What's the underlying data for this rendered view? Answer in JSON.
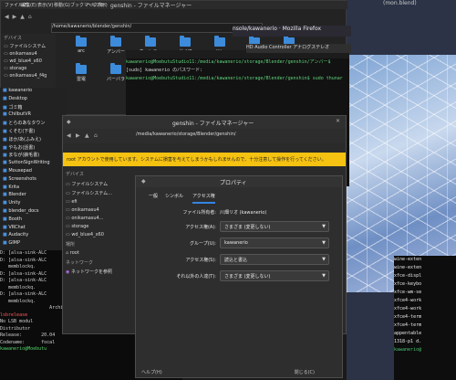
{
  "top_fm": {
    "title": "genshin - ファイルマネージャー",
    "menu": [
      "ファイル(F)",
      "編集(E)",
      "表示(V)",
      "移動(G)",
      "ブックマーク(B)",
      "ヘルプ(H)"
    ],
    "path": "/home/kawanerio/blender/genshin/",
    "sidebar_header": "デバイス",
    "sidebar": [
      "ファイルシステム",
      "onikamasu4",
      "wd_blue4_x60",
      "storage",
      "onikamasu4_f4g"
    ],
    "folders": [
      {
        "label": "arc"
      },
      {
        "label": "アンバー"
      },
      {
        "label": "ウェンティ"
      },
      {
        "label": "ガイア"
      },
      {
        "label": "ジン"
      },
      {
        "label": "バイモン"
      },
      {
        "label": "夜蘭"
      },
      {
        "label": "雷電"
      },
      {
        "label": "バーバラ"
      }
    ]
  },
  "left_list": [
    "kawanerio",
    "Desktop",
    "ゴミ箱",
    "ChilbutVR",
    "とらのあなタウン",
    "くそむ(下書)",
    "ほか/あ(ふみえ)",
    "やもお(話書)",
    "まなが(鋏毛書)",
    "SuttonSignWriting",
    "Mousepad",
    "Screenshots",
    "Krita",
    "Blender",
    "Unity",
    "blender_docs",
    "Booth",
    "VRChat",
    "Audacity",
    "GIMP"
  ],
  "terminal_lines": [
    {
      "text": "D: [alsa-sink-ALC",
      "cls": ""
    },
    {
      "text": "D: [alsa-sink-ALC",
      "cls": ""
    },
    {
      "text": "   memblockq.",
      "cls": ""
    },
    {
      "text": "D: [alsa-sink-ALC",
      "cls": ""
    },
    {
      "text": "D: [alsa-sink-ALC",
      "cls": ""
    },
    {
      "text": "   memblockq.",
      "cls": ""
    },
    {
      "text": "D: [alsa-sink-ALC",
      "cls": ""
    },
    {
      "text": "   memblockq.",
      "cls": ""
    },
    {
      "text": "                  Archit",
      "cls": ""
    },
    {
      "text": "lsbrelease",
      "cls": "red"
    },
    {
      "text": "No LSB modul",
      "cls": ""
    },
    {
      "text": "Distributor",
      "cls": ""
    },
    {
      "text": "Release:       20.04",
      "cls": ""
    },
    {
      "text": "Codename:      focal",
      "cls": ""
    },
    {
      "text": "kawanerio@Moebutu",
      "cls": "grn"
    }
  ],
  "upper_term": {
    "tabs": "nsole/kawanerio · Mozilla Firefox",
    "audio": "HD Audio Controller アナログステレオ",
    "lines": [
      {
        "text": "kawanerio@MoebutuStudio11:/media/kawanerio/storage/Blender/genshin/アンバー$",
        "cls": "g"
      },
      {
        "text": "[sudo] kawanerio のパスワード:",
        "cls": ""
      },
      {
        "text": "kawanerio@MoebutuStudio11:/media/kawanerio/storage/Blender/genshin$ sudo thunar",
        "cls": "g"
      }
    ]
  },
  "fm2": {
    "title": "genshin - ファイルマネージャー",
    "path": "/media/kawanerio/storage/Blender/genshin/",
    "warning": "root アカウントで使用しています。システムに損害を与えてしまうかもしれませんので、十分注意して操作を行ってください。",
    "side_header": "デバイス",
    "side": [
      "ファイルシステム",
      "ファイルシステム...",
      "efi",
      "onikamasu4",
      "onikamasu4...",
      "storage",
      "wd_blue4_x60"
    ],
    "places_header": "場所",
    "places": [
      "root"
    ],
    "net_header": "ネットワーク",
    "net": [
      "ネットワークを参照"
    ]
  },
  "dialog": {
    "title": "プロパティ",
    "tabs": [
      "一般",
      "シンボル",
      "アクセス権"
    ],
    "owner_label": "ファイル所有者:",
    "owner_value": "川畑リオ (kawanerio)",
    "access_label": "アクセス権(A):",
    "access_value": "さまざま (変更しない)",
    "group_label": "グループ(U):",
    "group_value": "kawanerio",
    "group_access_label": "アクセス権(S):",
    "group_access_value": "読込と書込",
    "others_label": "それ以外の人達(T):",
    "others_value": "さまざま (変更しない)",
    "help": "ヘルプ(H)",
    "close": "閉じる(C)"
  },
  "right_bg": {
    "title": "(mon.blend)",
    "term_lines": [
      "wine-exten",
      "wine-exten",
      "xfce-displ",
      "xfce-keybo",
      "xfce-wm-se",
      "xfce4-work",
      "xfce4-work",
      "xfce4-term",
      "xfce4-term",
      "appentable",
      "1318-p1 d.",
      "kawanerio@"
    ]
  }
}
